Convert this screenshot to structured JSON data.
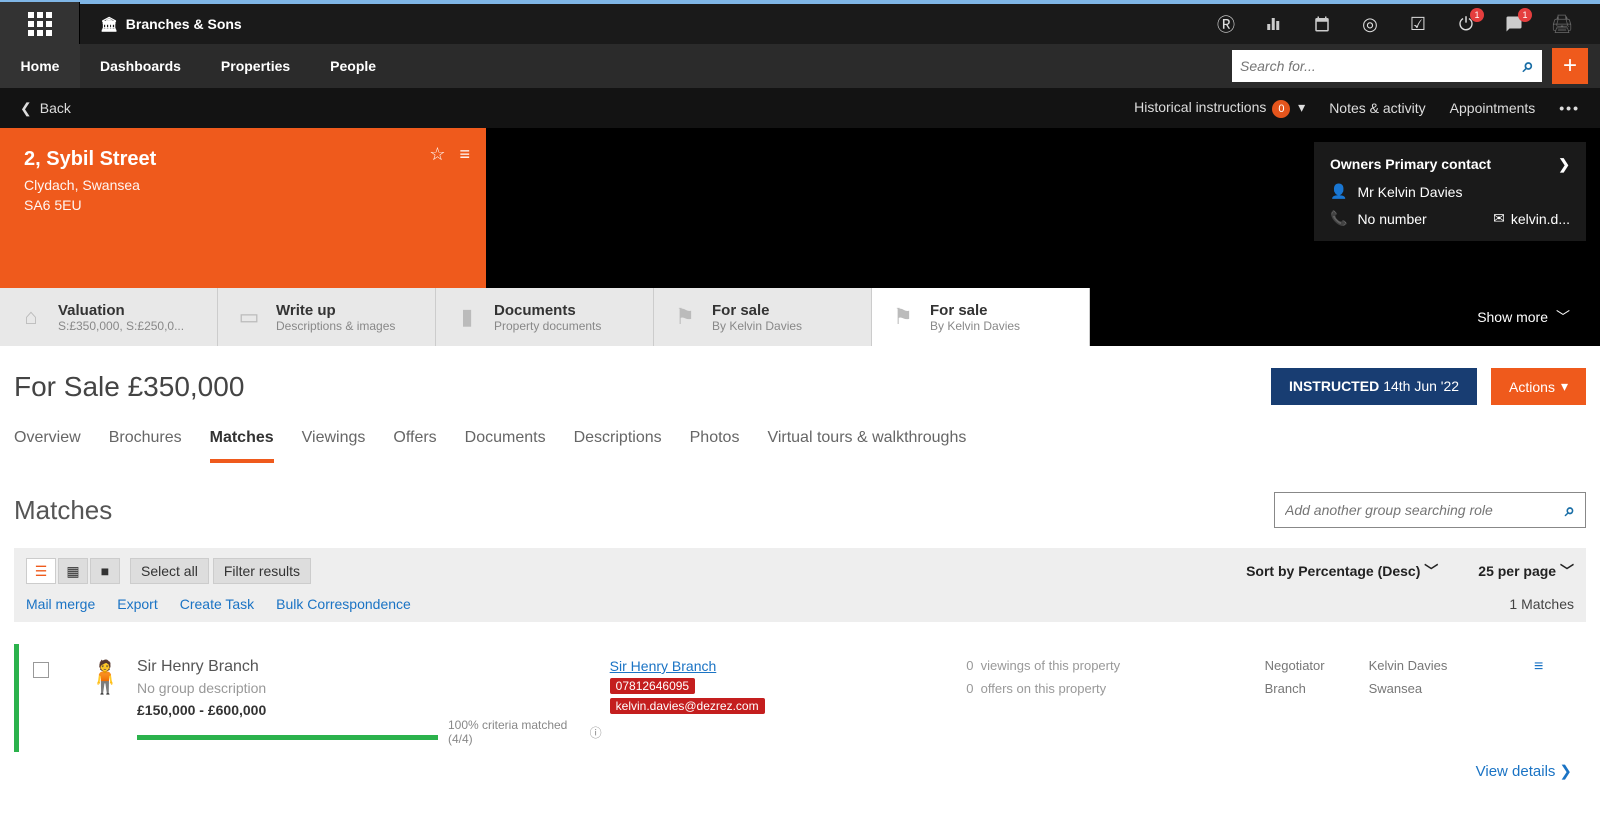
{
  "brand": {
    "name": "Branches & Sons"
  },
  "nav": {
    "home": "Home",
    "dashboards": "Dashboards",
    "properties": "Properties",
    "people": "People"
  },
  "search": {
    "placeholder": "Search for..."
  },
  "topbadges": {
    "alert": "1",
    "msg": "1"
  },
  "subbar": {
    "back": "Back",
    "historical": "Historical instructions",
    "historical_count": "0",
    "notes": "Notes & activity",
    "appts": "Appointments"
  },
  "property": {
    "title": "2, Sybil Street",
    "locality": "Clydach, Swansea",
    "postcode": "SA6 5EU"
  },
  "owner": {
    "heading": "Owners Primary contact",
    "name": "Mr Kelvin Davies",
    "phone": "No number",
    "email": "kelvin.d..."
  },
  "sections": [
    {
      "t1": "Valuation",
      "t2": "S:£350,000, S:£250,0..."
    },
    {
      "t1": "Write up",
      "t2": "Descriptions & images"
    },
    {
      "t1": "Documents",
      "t2": "Property documents"
    },
    {
      "t1": "For sale",
      "t2": "By Kelvin Davies"
    },
    {
      "t1": "For sale",
      "t2": "By Kelvin Davies"
    }
  ],
  "show_more": "Show more",
  "page": {
    "title": "For Sale £350,000",
    "status": "INSTRUCTED",
    "status_date": "14th Jun '22",
    "actions": "Actions"
  },
  "inner_tabs": [
    "Overview",
    "Brochures",
    "Matches",
    "Viewings",
    "Offers",
    "Documents",
    "Descriptions",
    "Photos",
    "Virtual tours & walkthroughs"
  ],
  "matches": {
    "heading": "Matches",
    "group_placeholder": "Add another group searching role",
    "select_all": "Select all",
    "filter": "Filter results",
    "sort": "Sort by Percentage (Desc)",
    "perpage": "25 per page",
    "links": {
      "mailmerge": "Mail merge",
      "export": "Export",
      "createtask": "Create Task",
      "bulk": "Bulk Correspondence"
    },
    "count": "1 Matches"
  },
  "item": {
    "name": "Sir Henry Branch",
    "desc": "No group description",
    "price": "£150,000 - £600,000",
    "progress_text": "100% criteria matched (4/4)",
    "link_name": "Sir Henry Branch",
    "phone": "07812646095",
    "email": "kelvin.davies@dezrez.com",
    "viewings_n": "0",
    "viewings_t": "viewings of this property",
    "offers_n": "0",
    "offers_t": "offers on this property",
    "negotiator_l": "Negotiator",
    "negotiator_v": "Kelvin Davies",
    "branch_l": "Branch",
    "branch_v": "Swansea",
    "view_details": "View details"
  }
}
